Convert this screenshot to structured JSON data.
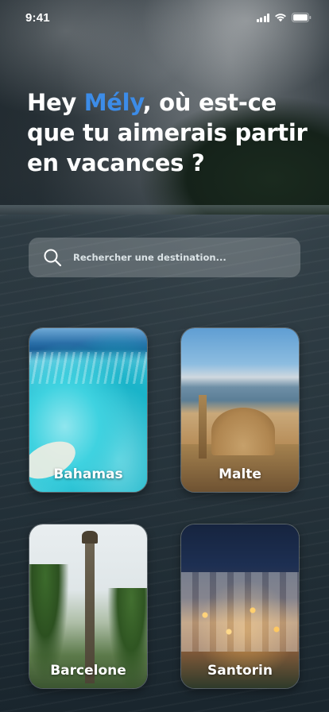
{
  "status_bar": {
    "time": "9:41",
    "icons": [
      "cellular-signal-icon",
      "wifi-icon",
      "battery-icon"
    ]
  },
  "header": {
    "greeting_prefix": "Hey ",
    "user_name": "Mély",
    "greeting_suffix": ", où est-ce que tu aimerais partir en vacances ?"
  },
  "search": {
    "placeholder": "Rechercher une destination...",
    "value": "",
    "icon": "search-icon"
  },
  "destinations": [
    {
      "label": "Bahamas"
    },
    {
      "label": "Malte"
    },
    {
      "label": "Barcelone"
    },
    {
      "label": "Santorin"
    }
  ],
  "colors": {
    "accent": "#3c8ce8",
    "text": "#ffffff",
    "search_background": "rgba(255,255,255,0.22)"
  }
}
